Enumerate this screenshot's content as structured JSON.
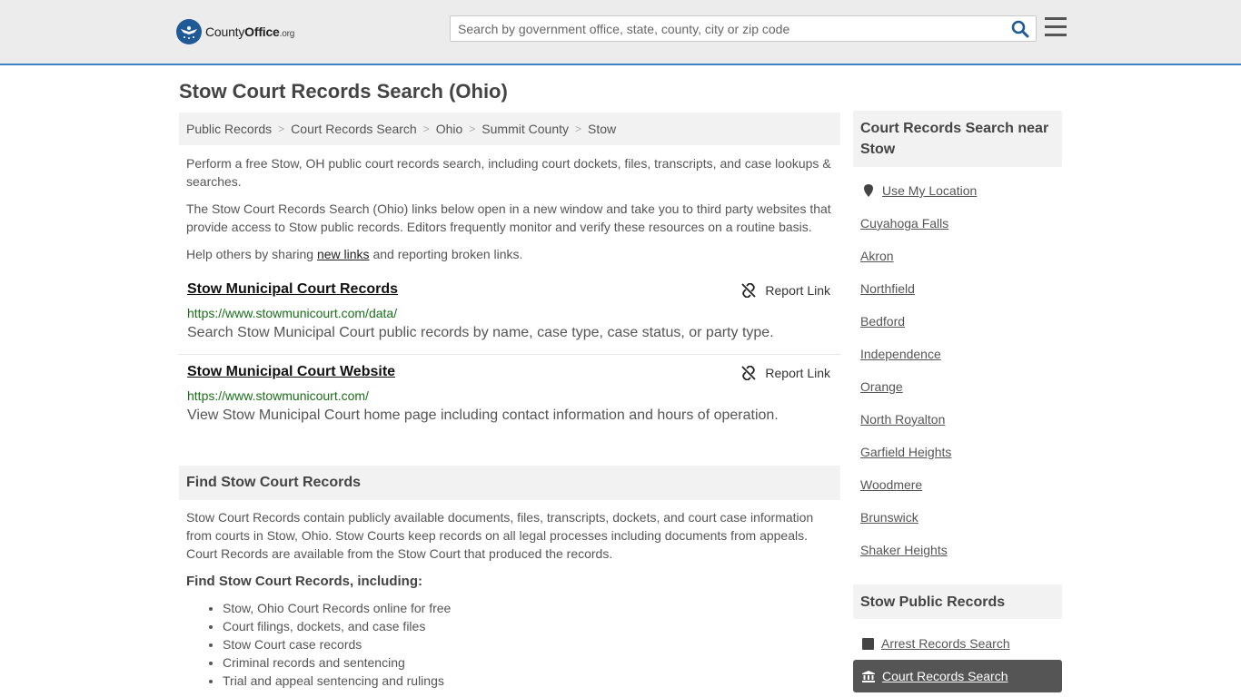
{
  "header": {
    "logo_part1": "County",
    "logo_part2": "Office",
    "logo_part3": ".org",
    "search_placeholder": "Search by government office, state, county, city or zip code"
  },
  "page": {
    "title": "Stow Court Records Search (Ohio)"
  },
  "breadcrumb": [
    "Public Records",
    "Court Records Search",
    "Ohio",
    "Summit County",
    "Stow"
  ],
  "intro": {
    "p1": "Perform a free Stow, OH public court records search, including court dockets, files, transcripts, and case lookups & searches.",
    "p2": "The Stow Court Records Search (Ohio) links below open in a new window and take you to third party websites that provide access to Stow public records. Editors frequently monitor and verify these resources on a routine basis.",
    "p3_before": "Help others by sharing ",
    "p3_link": "new links",
    "p3_after": " and reporting broken links."
  },
  "results": [
    {
      "title": "Stow Municipal Court Records",
      "url": "https://www.stowmunicourt.com/data/",
      "description": "Search Stow Municipal Court public records by name, case type, case status, or party type.",
      "report_label": "Report Link"
    },
    {
      "title": "Stow Municipal Court Website",
      "url": "https://www.stowmunicourt.com/",
      "description": "View Stow Municipal Court home page including contact information and hours of operation.",
      "report_label": "Report Link"
    }
  ],
  "find_section": {
    "heading": "Find Stow Court Records",
    "paragraph": "Stow Court Records contain publicly available documents, files, transcripts, dockets, and court case information from courts in Stow, Ohio. Stow Courts keep records on all legal processes including documents from appeals. Court Records are available from the Stow Court that produced the records.",
    "subheading": "Find Stow Court Records, including:",
    "bullets": [
      "Stow, Ohio Court Records online for free",
      "Court filings, dockets, and case files",
      "Stow Court case records",
      "Criminal records and sentencing",
      "Trial and appeal sentencing and rulings"
    ]
  },
  "sidebar": {
    "nearby_heading": "Court Records Search near Stow",
    "use_location": "Use My Location",
    "nearby": [
      "Cuyahoga Falls",
      "Akron",
      "Northfield",
      "Bedford",
      "Independence",
      "Orange",
      "North Royalton",
      "Garfield Heights",
      "Woodmere",
      "Brunswick",
      "Shaker Heights"
    ],
    "public_heading": "Stow Public Records",
    "public_links": [
      "Arrest Records Search",
      "Court Records Search"
    ]
  },
  "colors": {
    "accent_blue": "#3d82c4",
    "url_green": "#1a6e1a",
    "active_item_bg": "#555555"
  }
}
